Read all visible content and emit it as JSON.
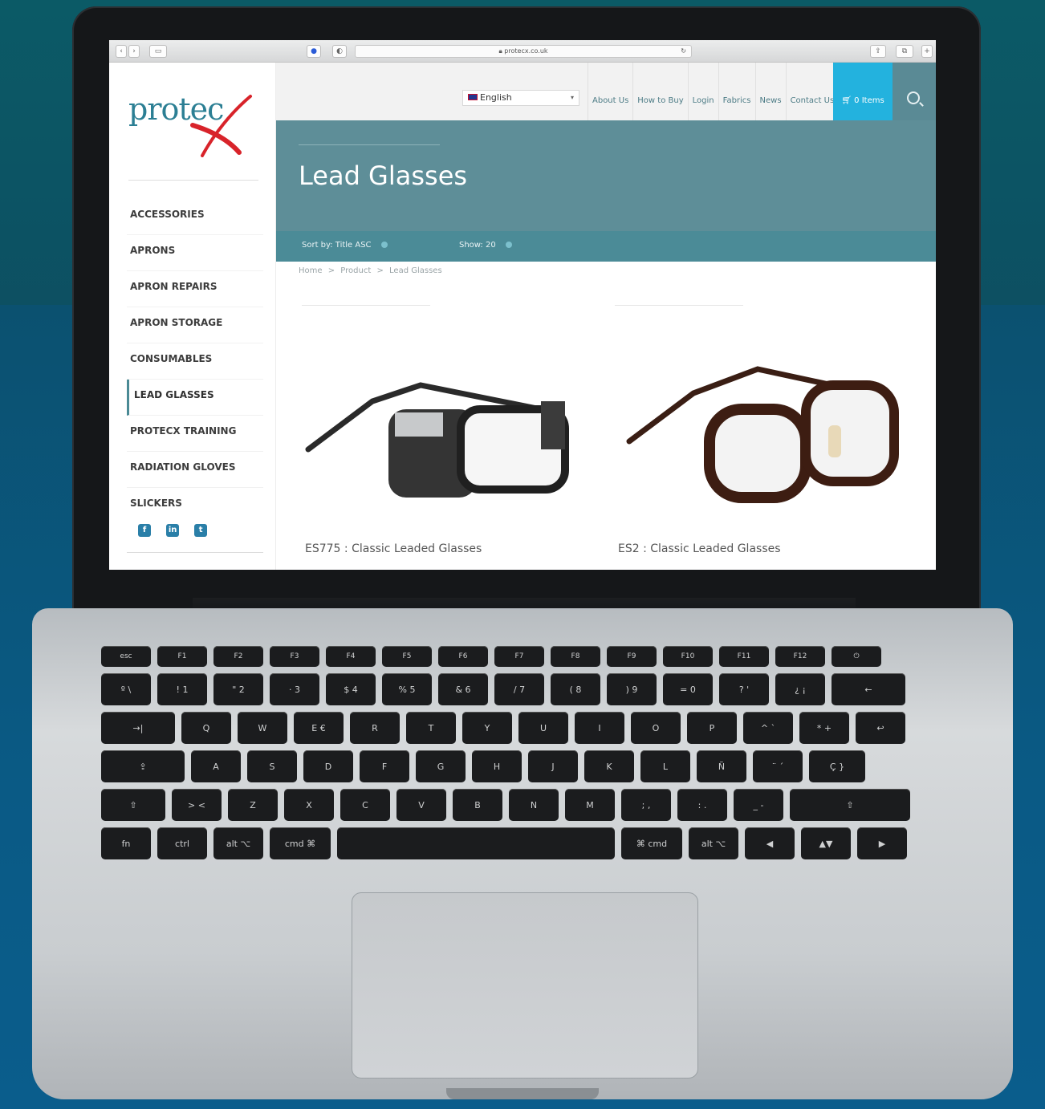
{
  "browser": {
    "url": "protecx.co.uk"
  },
  "brand": {
    "logo_text": "protec",
    "accent_color": "#23b2de",
    "hero_color": "#5e8e98",
    "logo_color": "#2c7f94",
    "x_color": "#d8232a"
  },
  "sidebar": {
    "categories": [
      {
        "label": "ACCESSORIES"
      },
      {
        "label": "APRONS"
      },
      {
        "label": "APRON REPAIRS"
      },
      {
        "label": "APRON STORAGE"
      },
      {
        "label": "CONSUMABLES"
      },
      {
        "label": "LEAD GLASSES",
        "active": true
      },
      {
        "label": "PROTECX TRAINING"
      },
      {
        "label": "RADIATION GLOVES"
      },
      {
        "label": "SLICKERS"
      }
    ],
    "social": [
      "facebook-icon",
      "linkedin-icon",
      "twitter-icon"
    ]
  },
  "topnav": {
    "language": "English",
    "links": [
      {
        "label": "About Us"
      },
      {
        "label": "How to Buy"
      },
      {
        "label": "Login"
      },
      {
        "label": "Fabrics"
      },
      {
        "label": "News"
      },
      {
        "label": "Contact Us"
      }
    ],
    "cart_label": "0 Items"
  },
  "page": {
    "title": "Lead Glasses",
    "sort_label": "Sort by: Title ASC",
    "show_label": "Show: 20",
    "breadcrumb": [
      "Home",
      ">",
      "Product",
      ">",
      "Lead Glasses"
    ]
  },
  "products": [
    {
      "name": "ES775 : Classic Leaded Glasses"
    },
    {
      "name": "ES2 : Classic Leaded Glasses"
    }
  ],
  "keyboard": {
    "fn_row": [
      "esc",
      "F1",
      "F2",
      "F3",
      "F4",
      "F5",
      "F6",
      "F7",
      "F8",
      "F9",
      "F10",
      "F11",
      "F12",
      "⏻"
    ],
    "num_row": [
      "º \\",
      "! 1",
      "\" 2",
      "· 3",
      "$ 4",
      "% 5",
      "& 6",
      "/ 7",
      "( 8",
      ") 9",
      "= 0",
      "? '",
      "¿ ¡",
      "←"
    ],
    "q_row": [
      "→|",
      "Q",
      "W",
      "E €",
      "R",
      "T",
      "Y",
      "U",
      "I",
      "O",
      "P",
      "^ `",
      "* +",
      "↩"
    ],
    "a_row": [
      "⇪",
      "A",
      "S",
      "D",
      "F",
      "G",
      "H",
      "J",
      "K",
      "L",
      "Ñ",
      "¨ ´",
      "Ç }"
    ],
    "z_row": [
      "⇧",
      "> <",
      "Z",
      "X",
      "C",
      "V",
      "B",
      "N",
      "M",
      "; ,",
      ": .",
      "_ -",
      "⇧"
    ],
    "bottom_row": [
      "fn",
      "ctrl",
      "alt ⌥",
      "cmd ⌘",
      "",
      "⌘ cmd",
      "alt ⌥",
      "◀",
      "▲▼",
      "▶"
    ]
  }
}
